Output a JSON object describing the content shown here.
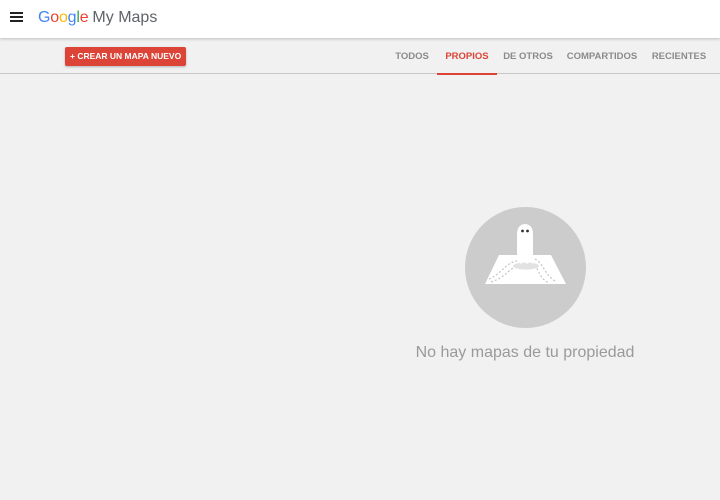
{
  "header": {
    "brand_letters": [
      {
        "char": "G",
        "color": "#4285F4"
      },
      {
        "char": "o",
        "color": "#EA4335"
      },
      {
        "char": "o",
        "color": "#FBBC05"
      },
      {
        "char": "g",
        "color": "#4285F4"
      },
      {
        "char": "l",
        "color": "#34A853"
      },
      {
        "char": "e",
        "color": "#EA4335"
      }
    ],
    "app_name": "My Maps",
    "menu_icon": "hamburger-menu-icon"
  },
  "toolbar": {
    "create_label": "+ CREAR UN MAPA NUEVO",
    "accent_color": "#db4437",
    "tabs": [
      {
        "label": "TODOS",
        "active": false
      },
      {
        "label": "PROPIOS",
        "active": true
      },
      {
        "label": "DE OTROS",
        "active": false
      },
      {
        "label": "COMPARTIDOS",
        "active": false
      },
      {
        "label": "RECIENTES",
        "active": false
      }
    ]
  },
  "empty_state": {
    "illustration": "ghost-on-map-icon",
    "message": "No hay mapas de tu propiedad"
  }
}
